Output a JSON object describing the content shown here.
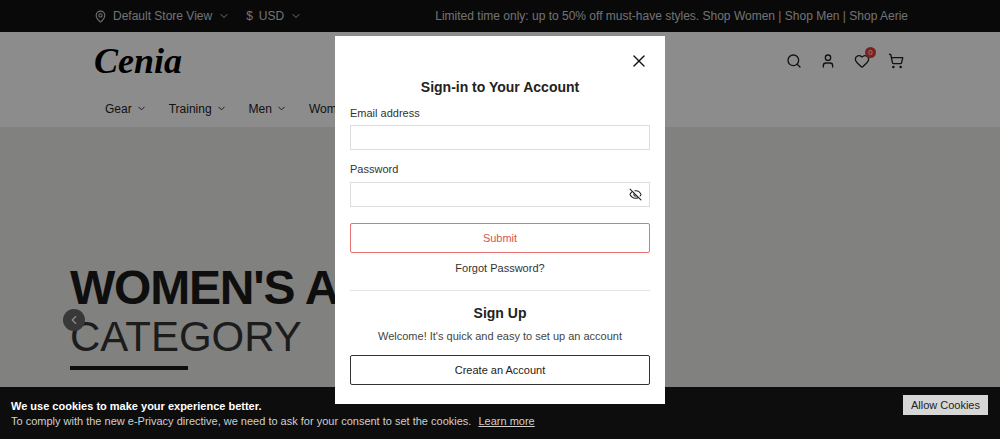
{
  "top_bar": {
    "store": "Default Store View",
    "currency_symbol": "$",
    "currency": "USD",
    "promo": "Limited time only: up to 50% off must-have styles. Shop Women | Shop Men | Shop Aerie"
  },
  "header": {
    "logo": "Cenia",
    "wishlist_count": "0"
  },
  "nav": [
    {
      "label": "Gear"
    },
    {
      "label": "Training"
    },
    {
      "label": "Men"
    },
    {
      "label": "Wome"
    }
  ],
  "hero": {
    "title": "WOMEN'S ACCE",
    "subtitle": "CATEGORY"
  },
  "modal": {
    "title": "Sign-in to Your Account",
    "email_label": "Email address",
    "email_value": "",
    "password_label": "Password",
    "password_value": "",
    "submit": "Submit",
    "forgot": "Forgot Password?",
    "signup_title": "Sign Up",
    "signup_text": "Welcome! It's quick and easy to set up an account",
    "create": "Create an Account"
  },
  "cookie_bar": {
    "title": "We use cookies to make your experience better.",
    "text": "To comply with the new e-Privacy directive, we need to ask for your consent to set the cookies.",
    "link": "Learn more",
    "button": "Allow Cookies"
  }
}
